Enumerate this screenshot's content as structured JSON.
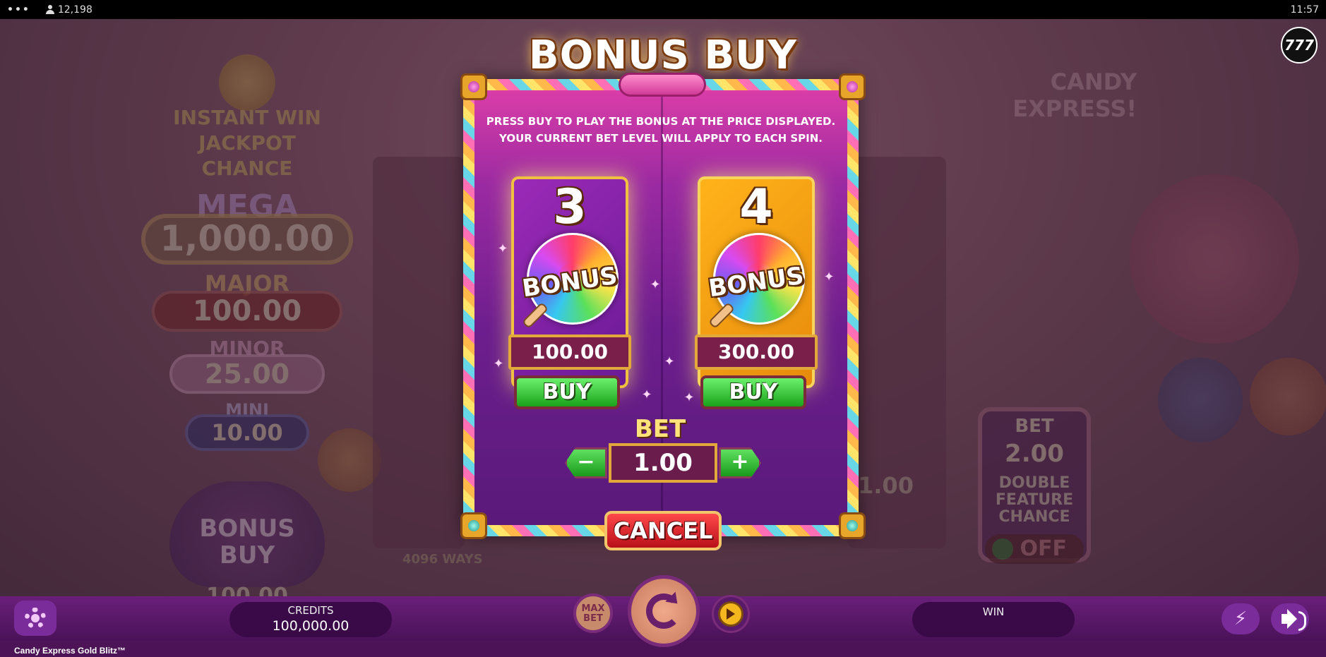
{
  "status_bar": {
    "menu_icon": "dots-icon",
    "player_count": "12,198",
    "time": "11:57"
  },
  "brand_badge": "777",
  "background": {
    "instant_win_text": "INSTANT WIN JACKPOT CHANCE",
    "jackpots": [
      {
        "label": "MEGA",
        "value": "1,000.00"
      },
      {
        "label": "MAJOR",
        "value": "100.00"
      },
      {
        "label": "MINOR",
        "value": "25.00"
      },
      {
        "label": "MINI",
        "value": "10.00"
      }
    ],
    "bonus_buy_label": "BONUS BUY",
    "bonus_buy_price": "100.00",
    "ways_text": "4096 WAYS",
    "reel_value": "1.00",
    "game_logo_text": "CANDY EXPRESS!",
    "side_bet": {
      "label": "BET",
      "value": "2.00",
      "description": "DOUBLE FEATURE CHANCE",
      "toggle_state": "OFF"
    }
  },
  "modal": {
    "title": "BONUS BUY",
    "instructions": "PRESS BUY TO PLAY THE BONUS AT THE PRICE DISPLAYED. YOUR CURRENT BET LEVEL WILL APPLY TO EACH SPIN.",
    "options": [
      {
        "count": "3",
        "badge_text": "BONUS",
        "price": "100.00",
        "buy_label": "BUY"
      },
      {
        "count": "4",
        "badge_text": "BONUS",
        "price": "300.00",
        "buy_label": "BUY"
      }
    ],
    "bet_label": "BET",
    "bet_value": "1.00",
    "minus_label": "−",
    "plus_label": "+",
    "cancel_label": "CANCEL"
  },
  "bottom_bar": {
    "credits_label": "CREDITS",
    "credits_value": "100,000.00",
    "max_bet_label": "MAX BET",
    "win_label": "WIN",
    "win_value": "",
    "game_name": "Candy Express Gold Blitz™"
  },
  "colors": {
    "accent_purple": "#6a1f7a",
    "buy_green": "#1aa21a",
    "cancel_red": "#b90f1a",
    "gold": "#e3a83a"
  }
}
